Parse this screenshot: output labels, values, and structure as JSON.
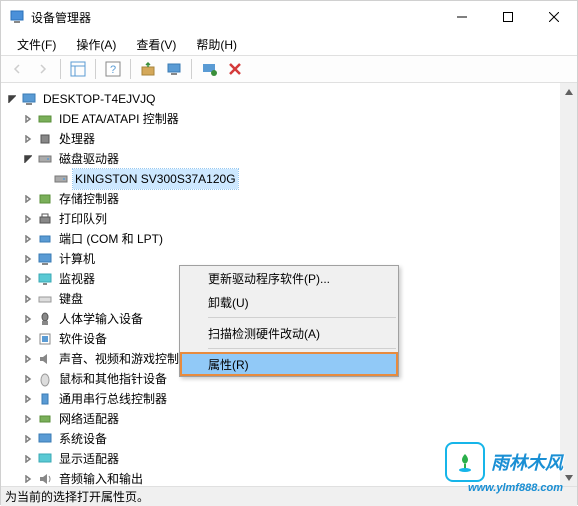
{
  "window": {
    "title": "设备管理器"
  },
  "menubar": {
    "file": "文件(F)",
    "action": "操作(A)",
    "view": "查看(V)",
    "help": "帮助(H)"
  },
  "tree": {
    "root": "DESKTOP-T4EJVJQ",
    "ide": "IDE ATA/ATAPI 控制器",
    "cpu": "处理器",
    "disk": "磁盘驱动器",
    "disk_child": "KINGSTON SV300S37A120G",
    "storage": "存储控制器",
    "print": "打印队列",
    "ports": "端口 (COM 和 LPT)",
    "computer": "计算机",
    "monitor": "监视器",
    "keyboard": "键盘",
    "hid": "人体学输入设备",
    "software": "软件设备",
    "sound": "声音、视频和游戏控制器",
    "mouse": "鼠标和其他指针设备",
    "usb": "通用串行总线控制器",
    "network": "网络适配器",
    "system": "系统设备",
    "display": "显示适配器",
    "audio": "音频输入和输出"
  },
  "context_menu": {
    "update": "更新驱动程序软件(P)...",
    "uninstall": "卸载(U)",
    "scan": "扫描检测硬件改动(A)",
    "properties": "属性(R)"
  },
  "statusbar": {
    "text": "为当前的选择打开属性页。"
  },
  "watermark": {
    "text": "雨林木风",
    "url": "www.ylmf888.com"
  }
}
